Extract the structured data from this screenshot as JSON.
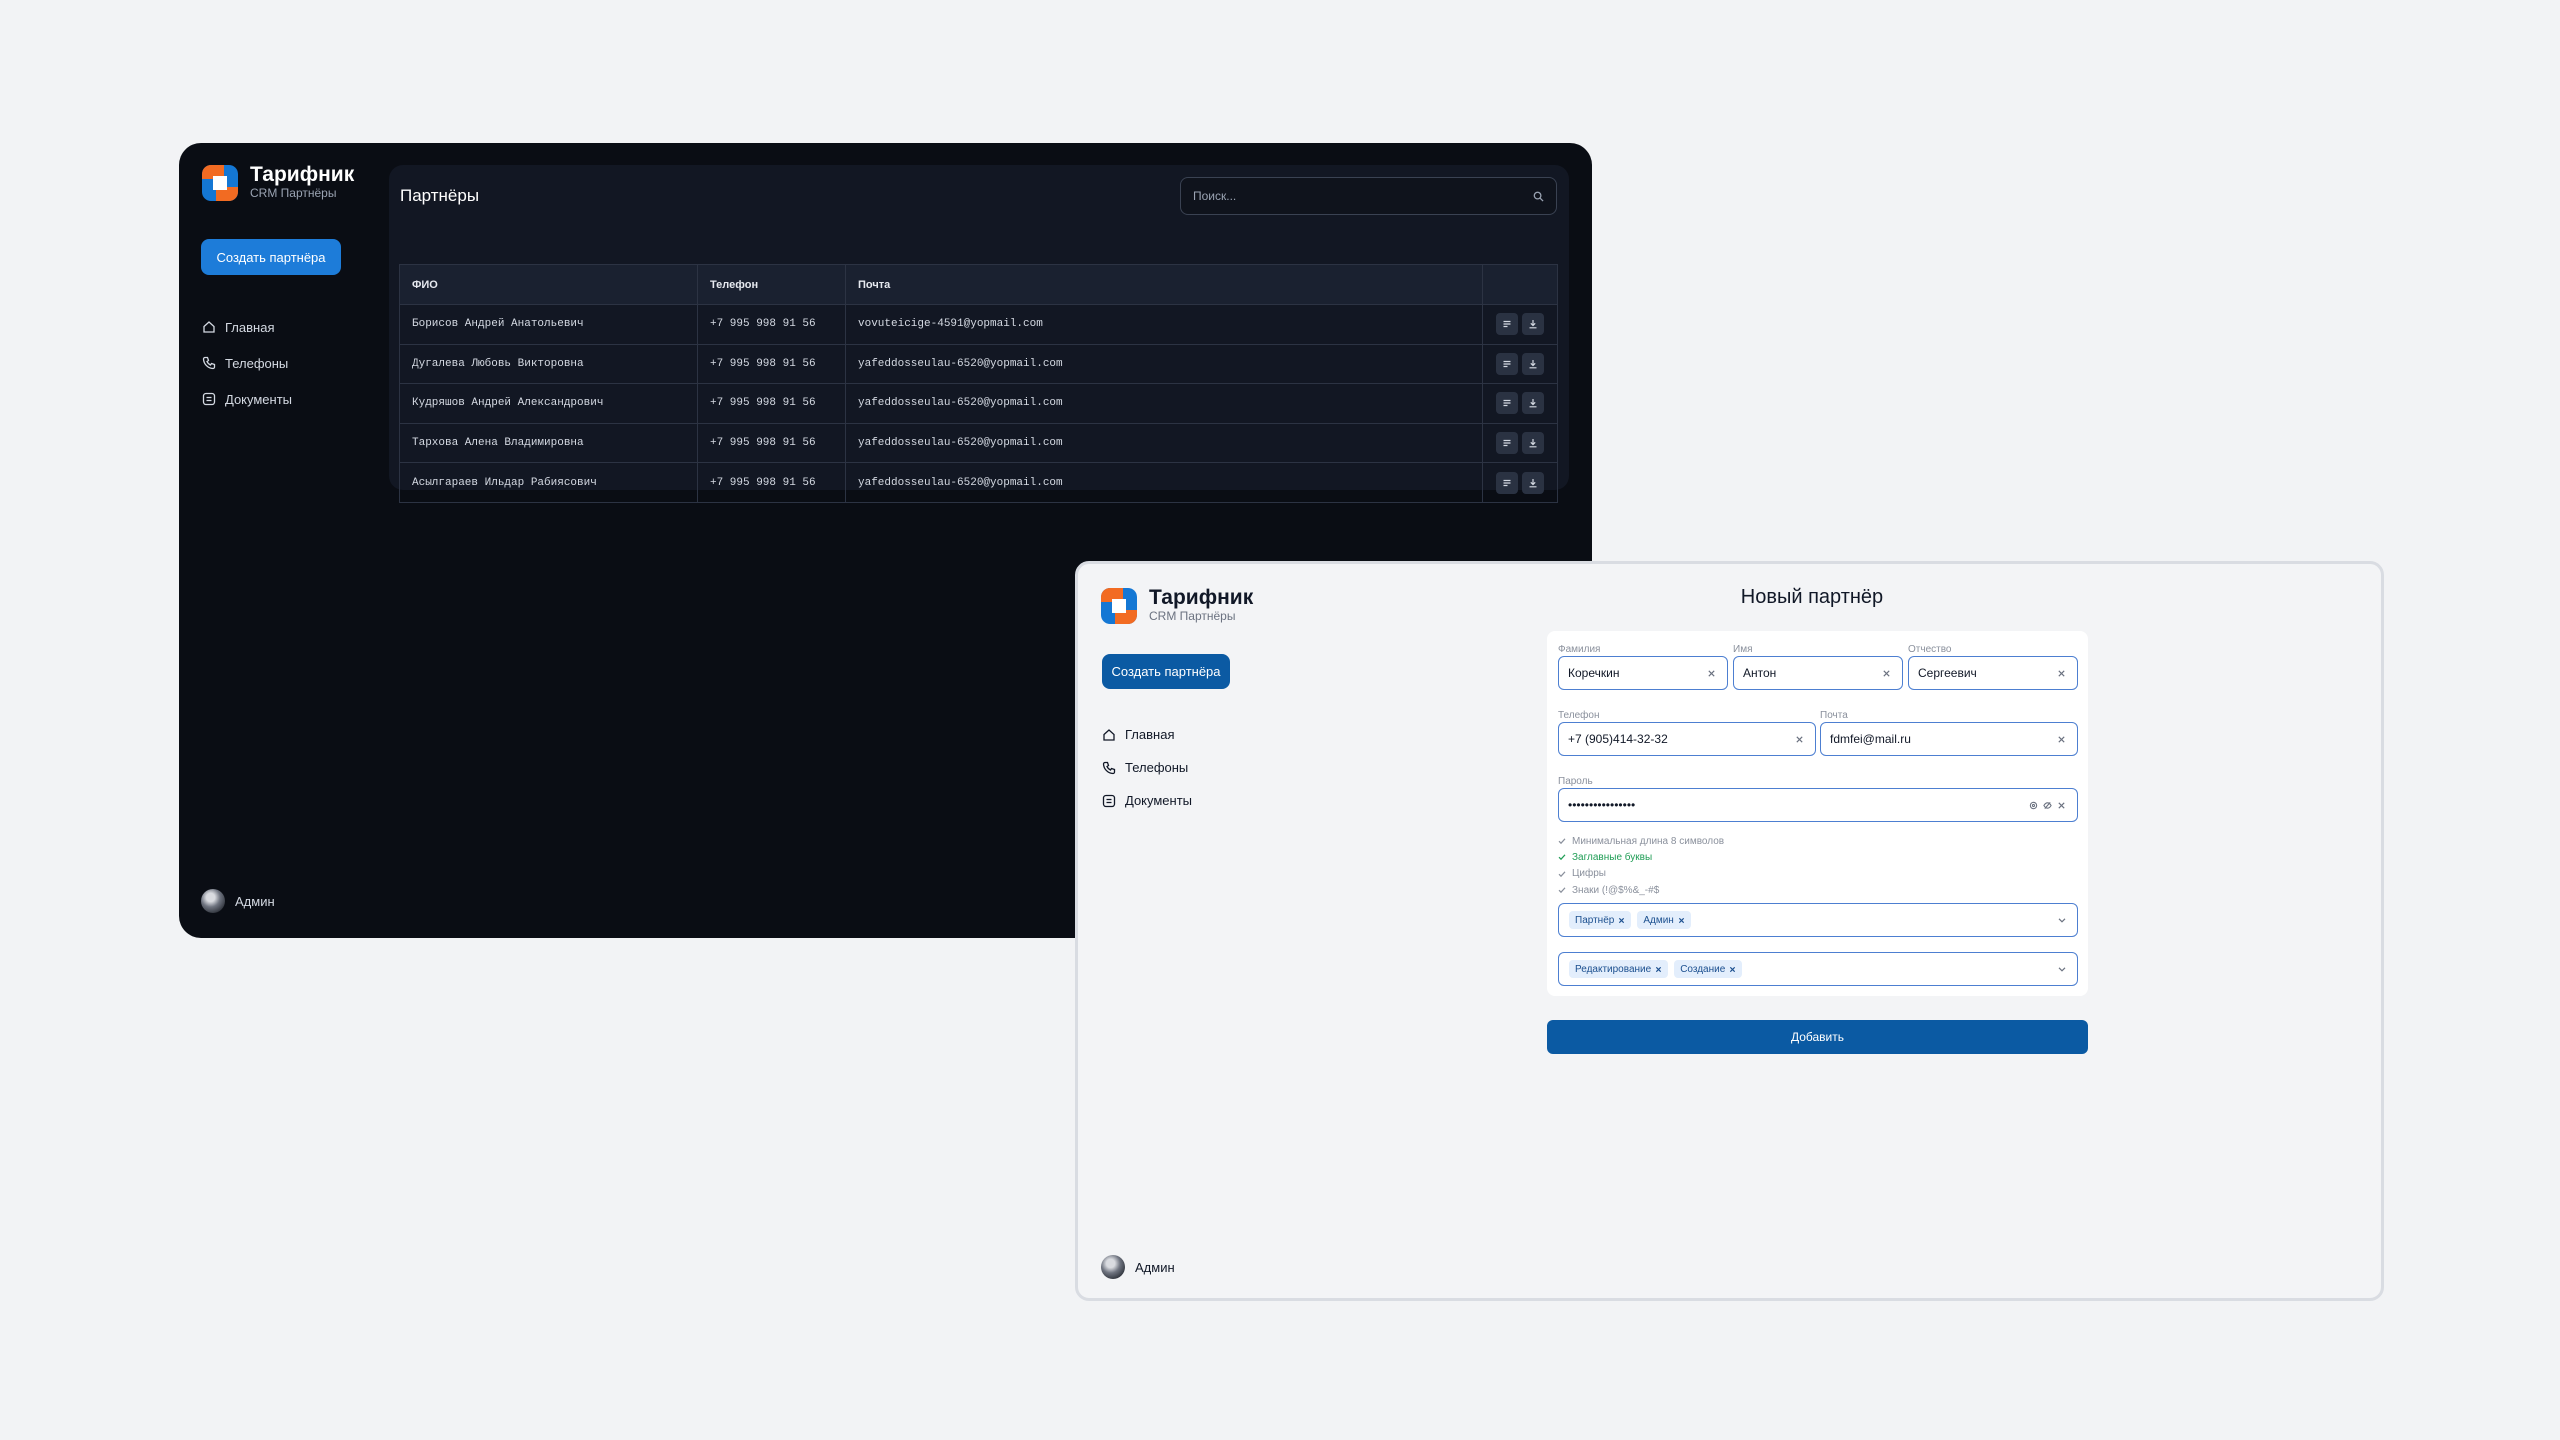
{
  "brand": {
    "title": "Тарифник",
    "subtitle": "CRM Партнёры",
    "colors": {
      "accent_dark": "#1d7cd9",
      "accent_light": "#0b5aa3",
      "logo_orange": "#f26b22",
      "logo_blue": "#1477d4"
    }
  },
  "nav": [
    {
      "label": "Главная",
      "icon": "home-icon"
    },
    {
      "label": "Телефоны",
      "icon": "phone-icon"
    },
    {
      "label": "Документы",
      "icon": "document-icon"
    }
  ],
  "create_partner_label": "Создать партнёра",
  "user": {
    "name": "Админ"
  },
  "partners_page": {
    "title": "Партнёры",
    "search_placeholder": "Поиск...",
    "columns": [
      "ФИО",
      "Телефон",
      "Почта"
    ],
    "rows": [
      {
        "name": "Борисов Андрей Анатольевич",
        "phone": "+7 995 998 91 56",
        "email": "vovuteicige-4591@yopmail.com"
      },
      {
        "name": "Дугалева Любовь Викторовна",
        "phone": "+7 995 998 91 56",
        "email": "yafeddosseulau-6520@yopmail.com"
      },
      {
        "name": "Кудряшов Андрей Александрович",
        "phone": "+7 995 998 91 56",
        "email": "yafeddosseulau-6520@yopmail.com"
      },
      {
        "name": "Тархова Алена Владимировна",
        "phone": "+7 995 998 91 56",
        "email": "yafeddosseulau-6520@yopmail.com"
      },
      {
        "name": "Асылгараев Ильдар Рабиясович",
        "phone": "+7 995 998 91 56",
        "email": "yafeddosseulau-6520@yopmail.com"
      }
    ]
  },
  "new_partner_form": {
    "title": "Новый партнёр",
    "fields": {
      "last_name": {
        "label": "Фамилия",
        "value": "Коречкин"
      },
      "first_name": {
        "label": "Имя",
        "value": "Антон"
      },
      "patronymic": {
        "label": "Отчество",
        "value": "Сергеевич"
      },
      "phone": {
        "label": "Телефон",
        "value": "+7 (905)414-32-32"
      },
      "email": {
        "label": "Почта",
        "value": "fdmfei@mail.ru"
      },
      "password": {
        "label": "Пароль",
        "value": "••••••••••••••••"
      }
    },
    "password_rules": [
      {
        "text": "Минимальная длина 8 символов",
        "ok": false
      },
      {
        "text": "Заглавные буквы",
        "ok": true
      },
      {
        "text": "Цифры",
        "ok": false
      },
      {
        "text": "Знаки (!@$%&_-#$",
        "ok": false
      }
    ],
    "roles": [
      "Партнёр",
      "Админ"
    ],
    "permissions": [
      "Редактирование",
      "Создание"
    ],
    "submit_label": "Добавить"
  }
}
